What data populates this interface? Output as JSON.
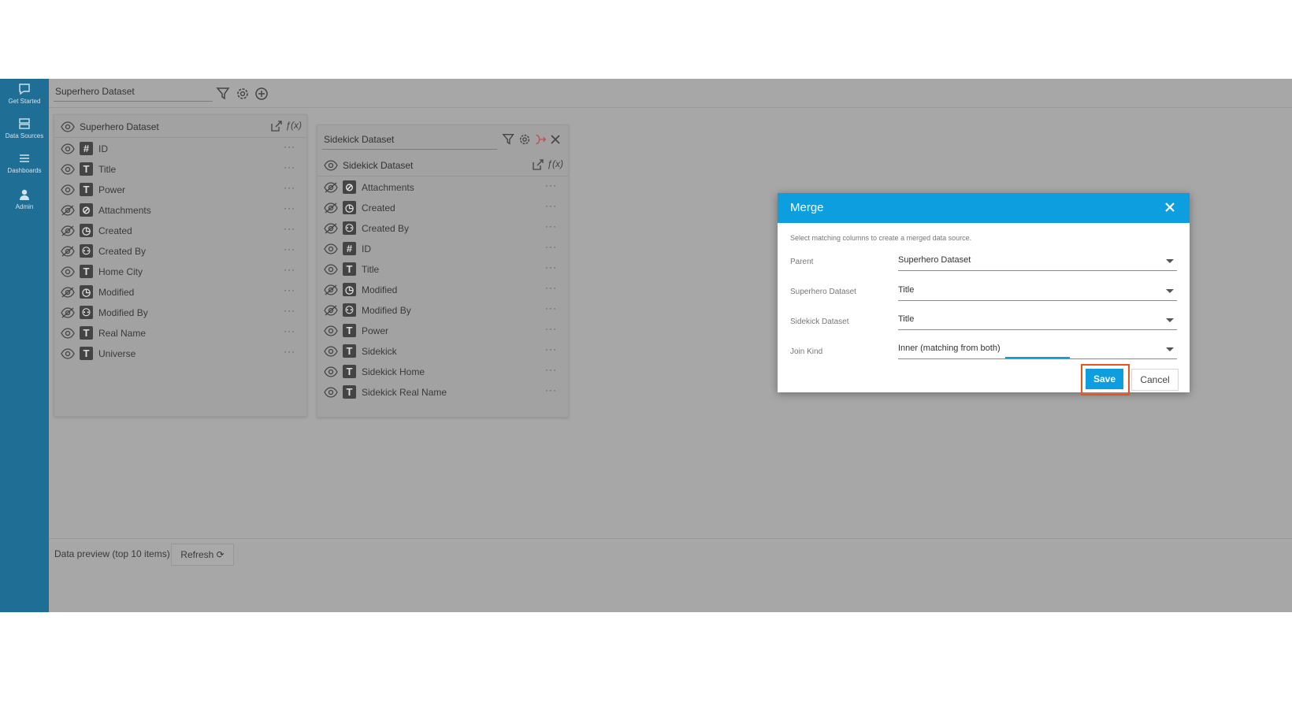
{
  "nav": {
    "items": [
      {
        "label": "Get Started",
        "icon": "chat-bubble-icon"
      },
      {
        "label": "Data Sources",
        "icon": "database-icon"
      },
      {
        "label": "Dashboards",
        "icon": "menu-lines-icon"
      },
      {
        "label": "Admin",
        "icon": "admin-user-icon"
      }
    ]
  },
  "topbar": {
    "dataset_name": "Superhero Dataset"
  },
  "superhero_panel": {
    "title": "Superhero Dataset",
    "columns": [
      {
        "name": "ID",
        "type": "#",
        "hidden": false
      },
      {
        "name": "Title",
        "type": "T",
        "hidden": false
      },
      {
        "name": "Power",
        "type": "T",
        "hidden": false
      },
      {
        "name": "Attachments",
        "type": "att",
        "hidden": true
      },
      {
        "name": "Created",
        "type": "clock",
        "hidden": true
      },
      {
        "name": "Created By",
        "type": "person",
        "hidden": true
      },
      {
        "name": "Home City",
        "type": "T",
        "hidden": false
      },
      {
        "name": "Modified",
        "type": "clock",
        "hidden": true
      },
      {
        "name": "Modified By",
        "type": "person",
        "hidden": true
      },
      {
        "name": "Real Name",
        "type": "T",
        "hidden": false
      },
      {
        "name": "Universe",
        "type": "T",
        "hidden": false
      }
    ]
  },
  "sidekick_panel": {
    "field_value": "Sidekick Dataset",
    "title": "Sidekick Dataset",
    "columns": [
      {
        "name": "Attachments",
        "type": "att",
        "hidden": true
      },
      {
        "name": "Created",
        "type": "clock",
        "hidden": true
      },
      {
        "name": "Created By",
        "type": "person",
        "hidden": true
      },
      {
        "name": "ID",
        "type": "#",
        "hidden": false
      },
      {
        "name": "Title",
        "type": "T",
        "hidden": false
      },
      {
        "name": "Modified",
        "type": "clock",
        "hidden": true
      },
      {
        "name": "Modified By",
        "type": "person",
        "hidden": true
      },
      {
        "name": "Power",
        "type": "T",
        "hidden": false
      },
      {
        "name": "Sidekick",
        "type": "T",
        "hidden": false
      },
      {
        "name": "Sidekick Home",
        "type": "T",
        "hidden": false
      },
      {
        "name": "Sidekick Real Name",
        "type": "T",
        "hidden": false
      }
    ]
  },
  "row_menu": "···",
  "bottom": {
    "preview_label": "Data preview (top 10 items)",
    "refresh_label": "Refresh ⟳"
  },
  "modal": {
    "title": "Merge",
    "description": "Select matching columns to create a merged data source.",
    "fields": [
      {
        "label": "Parent",
        "value": "Superhero Dataset"
      },
      {
        "label": "Superhero Dataset",
        "value": "Title"
      },
      {
        "label": "Sidekick Dataset",
        "value": "Title"
      },
      {
        "label": "Join Kind",
        "value": "Inner (matching from both)"
      }
    ],
    "save_label": "Save",
    "cancel_label": "Cancel"
  },
  "colors": {
    "nav_bg": "#1e6e96",
    "accent": "#0d9ee0",
    "highlight": "#e8531e",
    "overlay_bg": "#a7a7a7"
  }
}
